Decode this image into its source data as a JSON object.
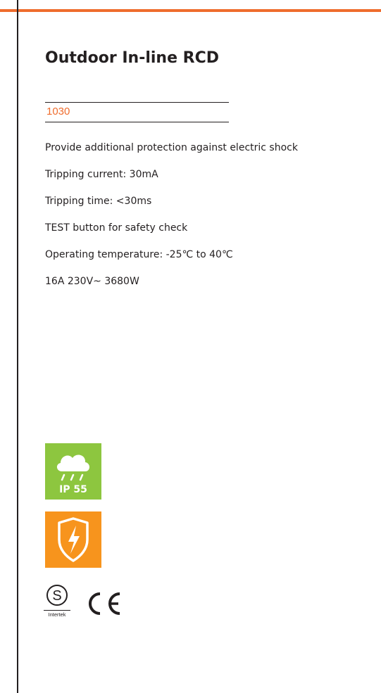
{
  "product": {
    "title": "Outdoor In-line RCD",
    "code": "1030"
  },
  "features": [
    "Provide additional protection against electric shock",
    "Tripping current: 30mA",
    "Tripping time: <30ms",
    "TEST button for safety check",
    "Operating temperature: -25℃  to 40℃",
    "16A 230V~ 3680W"
  ],
  "badges": {
    "ip_rating": "IP 55",
    "ip_icon": "rain-cloud-icon",
    "shock_icon": "shock-protection-shield-icon",
    "certification_mark": "Intertek",
    "certification_icon": "intertek-s-mark-icon",
    "ce_icon": "ce-mark-icon"
  },
  "colors": {
    "accent": "#ef6c2d",
    "ip_green": "#8dc63f",
    "shock_orange": "#f7941d",
    "text": "#231f20"
  }
}
